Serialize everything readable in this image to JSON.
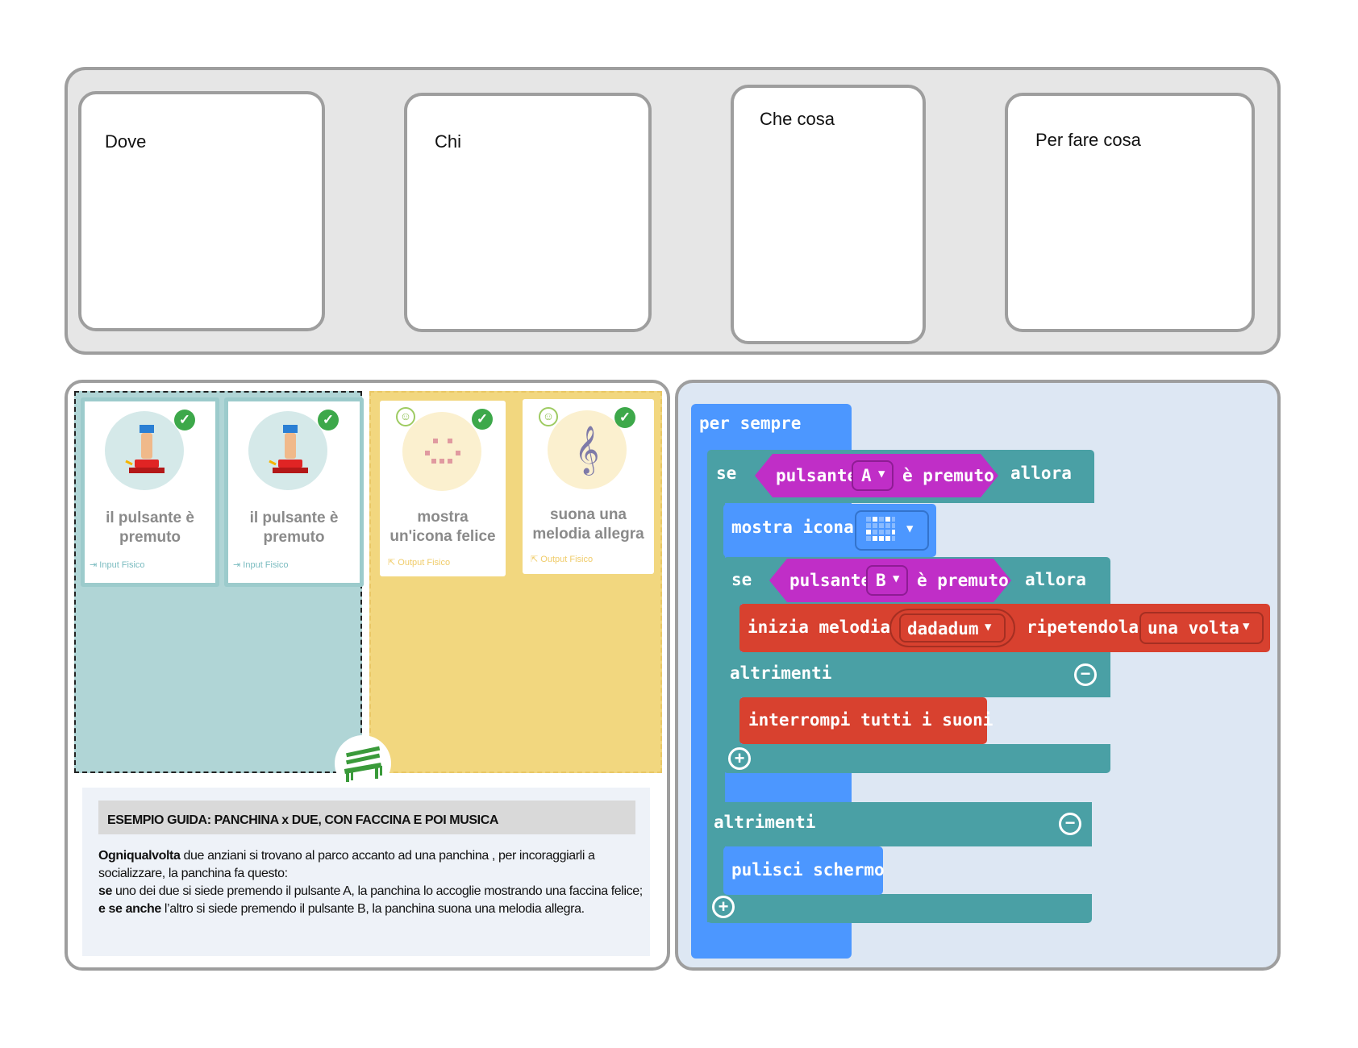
{
  "top": {
    "boxes": [
      "Dove",
      "Chi",
      "Che cosa",
      "Per fare cosa"
    ]
  },
  "cards": [
    {
      "title": "il pulsante è premuto",
      "tag": "Input Fisico"
    },
    {
      "title": "il pulsante è premuto",
      "tag": "Input Fisico"
    },
    {
      "title": "mostra un'icona felice",
      "tag": "Output Fisico"
    },
    {
      "title": "suona una melodia allegra",
      "tag": "Output Fisico"
    }
  ],
  "guide": {
    "heading": "ESEMPIO GUIDA: PANCHINA x DUE, CON FACCINA E POI MUSICA",
    "p1_bold": "Ogniqualvolta",
    "p1": " due anziani si trovano al parco accanto ad una panchina , per incoraggiarli a socializzare, la panchina fa questo:",
    "p2_bold": "se",
    "p2": " uno dei due si siede premendo il pulsante A, la panchina lo accoglie mostrando una faccina felice;",
    "p3_bold": "e se anche",
    "p3": " l’altro si siede premendo il pulsante B,  la panchina suona una melodia allegra."
  },
  "code": {
    "forever": "per sempre",
    "if1": "se",
    "button1_label": "pulsante",
    "button1_value": "A",
    "pressed1": "è premuto",
    "then1": "allora",
    "show_icon": "mostra icona",
    "if2": "se",
    "button2_label": "pulsante",
    "button2_value": "B",
    "pressed2": "è premuto",
    "then2": "allora",
    "start_melody": "inizia melodia",
    "melody_value": "dadadum",
    "repeat_label": "ripetendola",
    "repeat_value": "una volta",
    "else2": "altrimenti",
    "stop_sounds": "interrompi tutti i suoni",
    "else1": "altrimenti",
    "clear_screen": "pulisci schermo"
  },
  "colors": {
    "forever": "#4c97ff",
    "logic": "#4aa0a5",
    "input": "#c02ec7",
    "music": "#d8412f",
    "input_zone": "#b0d5d6",
    "output_zone": "#f2d77f"
  }
}
